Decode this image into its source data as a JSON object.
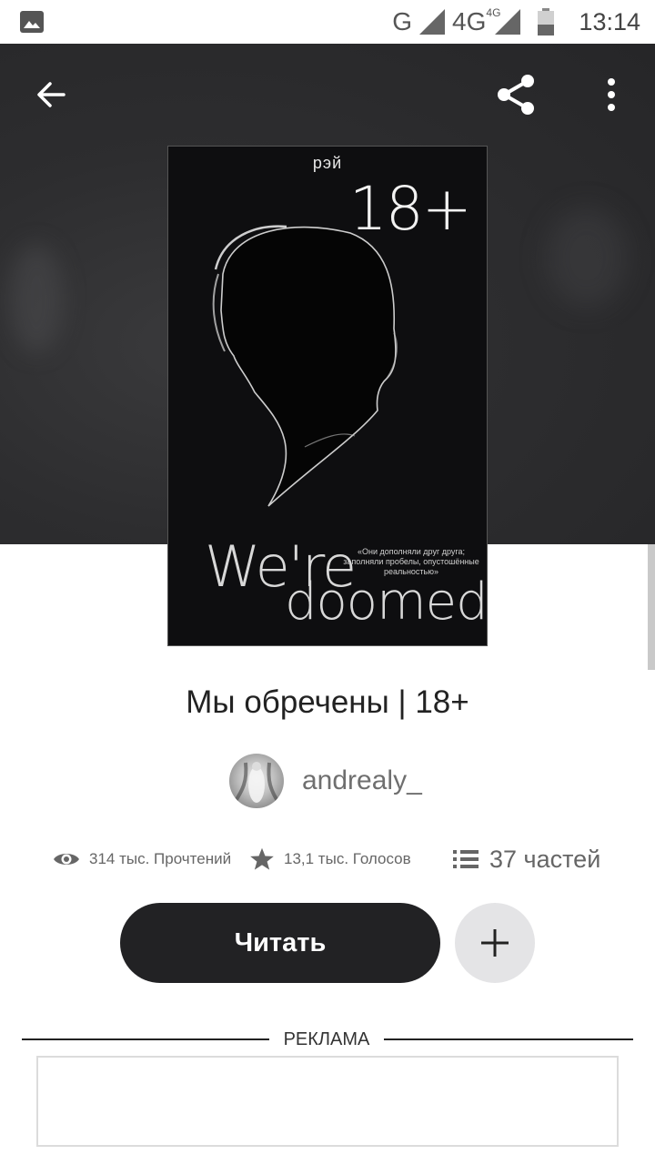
{
  "status_bar": {
    "network_g": "G",
    "network_4g": "4G",
    "network_4g_small": "4G",
    "time": "13:14"
  },
  "header": {
    "back_icon": "arrow-left-icon",
    "share_icon": "share-icon",
    "more_icon": "more-vertical-icon"
  },
  "cover": {
    "author": "рэй",
    "rating": "18+",
    "title_line1": "We're",
    "title_line2": "doomed",
    "quote": "«Они дополняли друг друга; заполняли пробелы, опустошённые реальностью»"
  },
  "story": {
    "title": "Мы обречены | 18+",
    "author_name": "andrealy_"
  },
  "stats": {
    "reads": "314 тыс. Прочтений",
    "votes": "13,1 тыс. Голосов",
    "parts": "37 частей",
    "icons": {
      "reads": "eye-icon",
      "votes": "star-icon",
      "parts": "list-icon"
    }
  },
  "actions": {
    "read_label": "Читать",
    "add_icon": "plus-icon"
  },
  "ad": {
    "label": "РЕКЛАМА"
  },
  "colors": {
    "hero_bg": "#2d2d2f",
    "primary_button": "#222224",
    "secondary_button": "#e4e4e6"
  }
}
